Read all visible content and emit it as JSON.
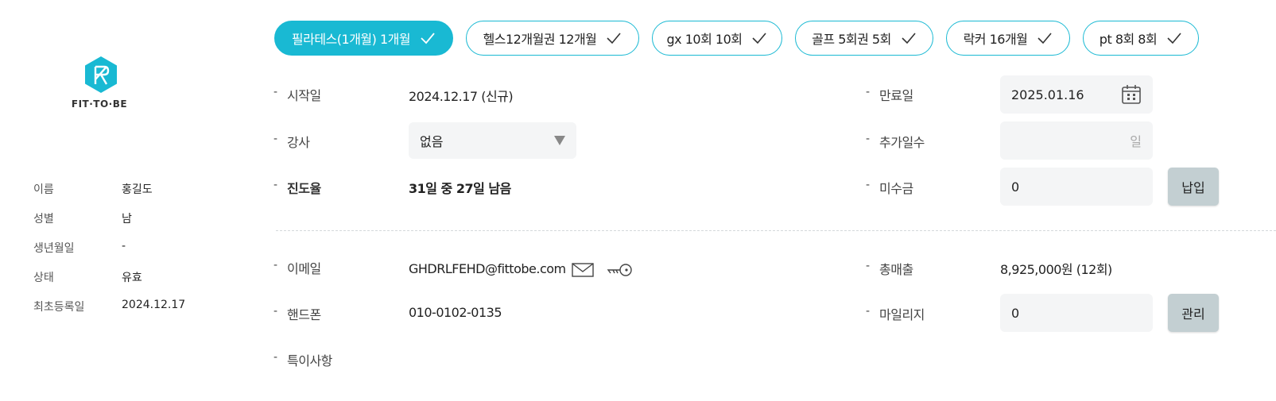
{
  "brand": {
    "name": "FIT·TO·BE",
    "accent": "#19b9d3"
  },
  "profile": [
    {
      "label": "이름",
      "value": "홍길도"
    },
    {
      "label": "성별",
      "value": "남"
    },
    {
      "label": "생년월일",
      "value": "-"
    },
    {
      "label": "상태",
      "value": "유효"
    },
    {
      "label": "최초등록일",
      "value": "2024.12.17"
    }
  ],
  "tabs": [
    {
      "label": "필라테스(1개월) 1개월",
      "active": true
    },
    {
      "label": "헬스12개월권 12개월",
      "active": false
    },
    {
      "label": "gx 10회 10회",
      "active": false
    },
    {
      "label": "골프 5회권 5회",
      "active": false
    },
    {
      "label": "락커 16개월",
      "active": false
    },
    {
      "label": "pt 8회 8회",
      "active": false
    }
  ],
  "form": {
    "dash": "-",
    "start_label": "시작일",
    "start_value": "2024.12.17 (신규)",
    "end_label": "만료일",
    "end_value": "2025.01.16",
    "instructor_label": "강사",
    "instructor_value": "없음",
    "extra_days_label": "추가일수",
    "extra_days_unit": "일",
    "progress_label": "진도율",
    "progress_value": "31일 중 27일 남음",
    "unpaid_label": "미수금",
    "unpaid_value": "0",
    "pay_button": "납입",
    "email_label": "이메일",
    "email_value": "GHDRLFEHD@fittobe.com",
    "phone_label": "핸드폰",
    "phone_value": "010-0102-0135",
    "notes_label": "특이사항",
    "sales_label": "총매출",
    "sales_value": "8,925,000원 (12회)",
    "mileage_label": "마일리지",
    "mileage_value": "0",
    "manage_button": "관리"
  }
}
